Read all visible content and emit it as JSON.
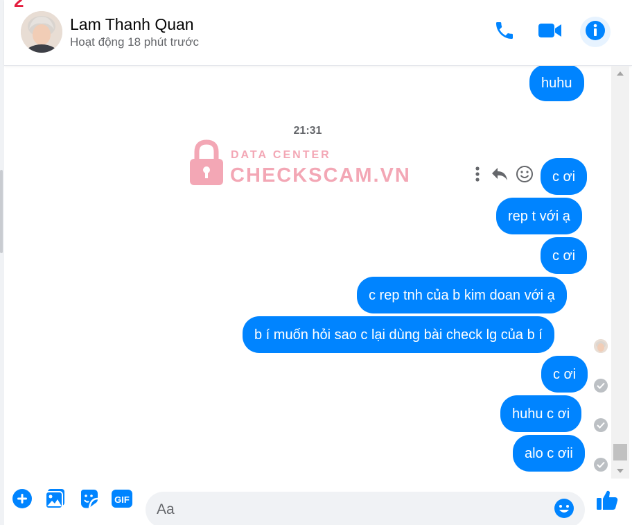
{
  "header": {
    "marker": "2",
    "contact_name": "Lam Thanh Quan",
    "contact_status": "Hoạt động 18 phút trước"
  },
  "watermark": {
    "top_text": "DATA CENTER",
    "main_text": "CHECKSCAM.VN"
  },
  "chat": {
    "timestamp": "21:31",
    "messages": [
      {
        "text": "huhu"
      },
      {
        "text": "c ơi"
      },
      {
        "text": "rep t với ạ"
      },
      {
        "text": "c ơi"
      },
      {
        "text": "c rep tnh của b kim doan với ạ"
      },
      {
        "text": "b í muốn hỏi sao c lại dùng bài check lg của b í"
      },
      {
        "text": "c ơi"
      },
      {
        "text": "huhu c ơi"
      },
      {
        "text": "alo c ơii"
      }
    ]
  },
  "composer": {
    "placeholder": "Aa"
  },
  "colors": {
    "accent": "#0084ff",
    "watermark": "#f3a7b5"
  },
  "icons": [
    "phone-icon",
    "video-call-icon",
    "info-icon",
    "more-vertical-icon",
    "reply-icon",
    "emoji-react-icon",
    "add-circle-icon",
    "image-icon",
    "sticker-icon",
    "gif-icon",
    "emoji-icon",
    "thumbs-up-icon",
    "sent-check-icon"
  ]
}
